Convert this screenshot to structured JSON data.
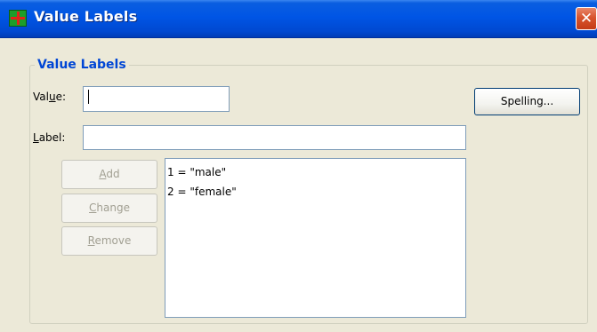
{
  "window": {
    "title": "Value Labels"
  },
  "group": {
    "label": "Value Labels"
  },
  "value_field": {
    "label_before": "Val",
    "label_mnemonic": "u",
    "label_after": "e:",
    "value": ""
  },
  "label_field": {
    "label_mnemonic": "L",
    "label_after": "abel:",
    "value": ""
  },
  "buttons": {
    "spelling": "Spelling...",
    "add": {
      "mnemonic": "A",
      "rest": "dd"
    },
    "change": {
      "mnemonic": "C",
      "rest": "hange"
    },
    "remove": {
      "mnemonic": "R",
      "rest": "emove"
    }
  },
  "value_labels": [
    "1 = \"male\"",
    "2 = \"female\""
  ]
}
